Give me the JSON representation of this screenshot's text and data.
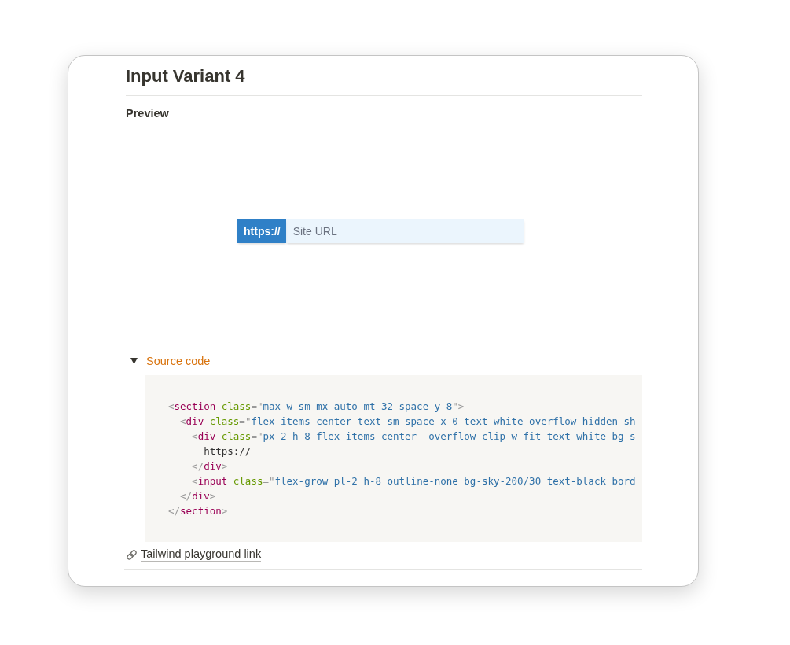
{
  "page": {
    "title": "Input Variant 4",
    "section_label": "Preview"
  },
  "preview": {
    "prefix": "https://",
    "input": {
      "placeholder": "Site URL"
    }
  },
  "source_code": {
    "toggle_label": "Source code",
    "expanded": true,
    "lines": [
      "<section class=\"max-w-sm mx-auto mt-32 space-y-8\">",
      "  <div class=\"flex items-center text-sm space-x-0 text-white overflow-hidden sh",
      "    <div class=\"px-2 h-8 flex items-center  overflow-clip w-fit text-white bg-s",
      "      https://",
      "    </div>",
      "    <input class=\"flex-grow pl-2 h-8 outline-none bg-sky-200/30 text-black bord",
      "  </div>",
      "</section>"
    ]
  },
  "link": {
    "label": "Tailwind playground link"
  }
}
